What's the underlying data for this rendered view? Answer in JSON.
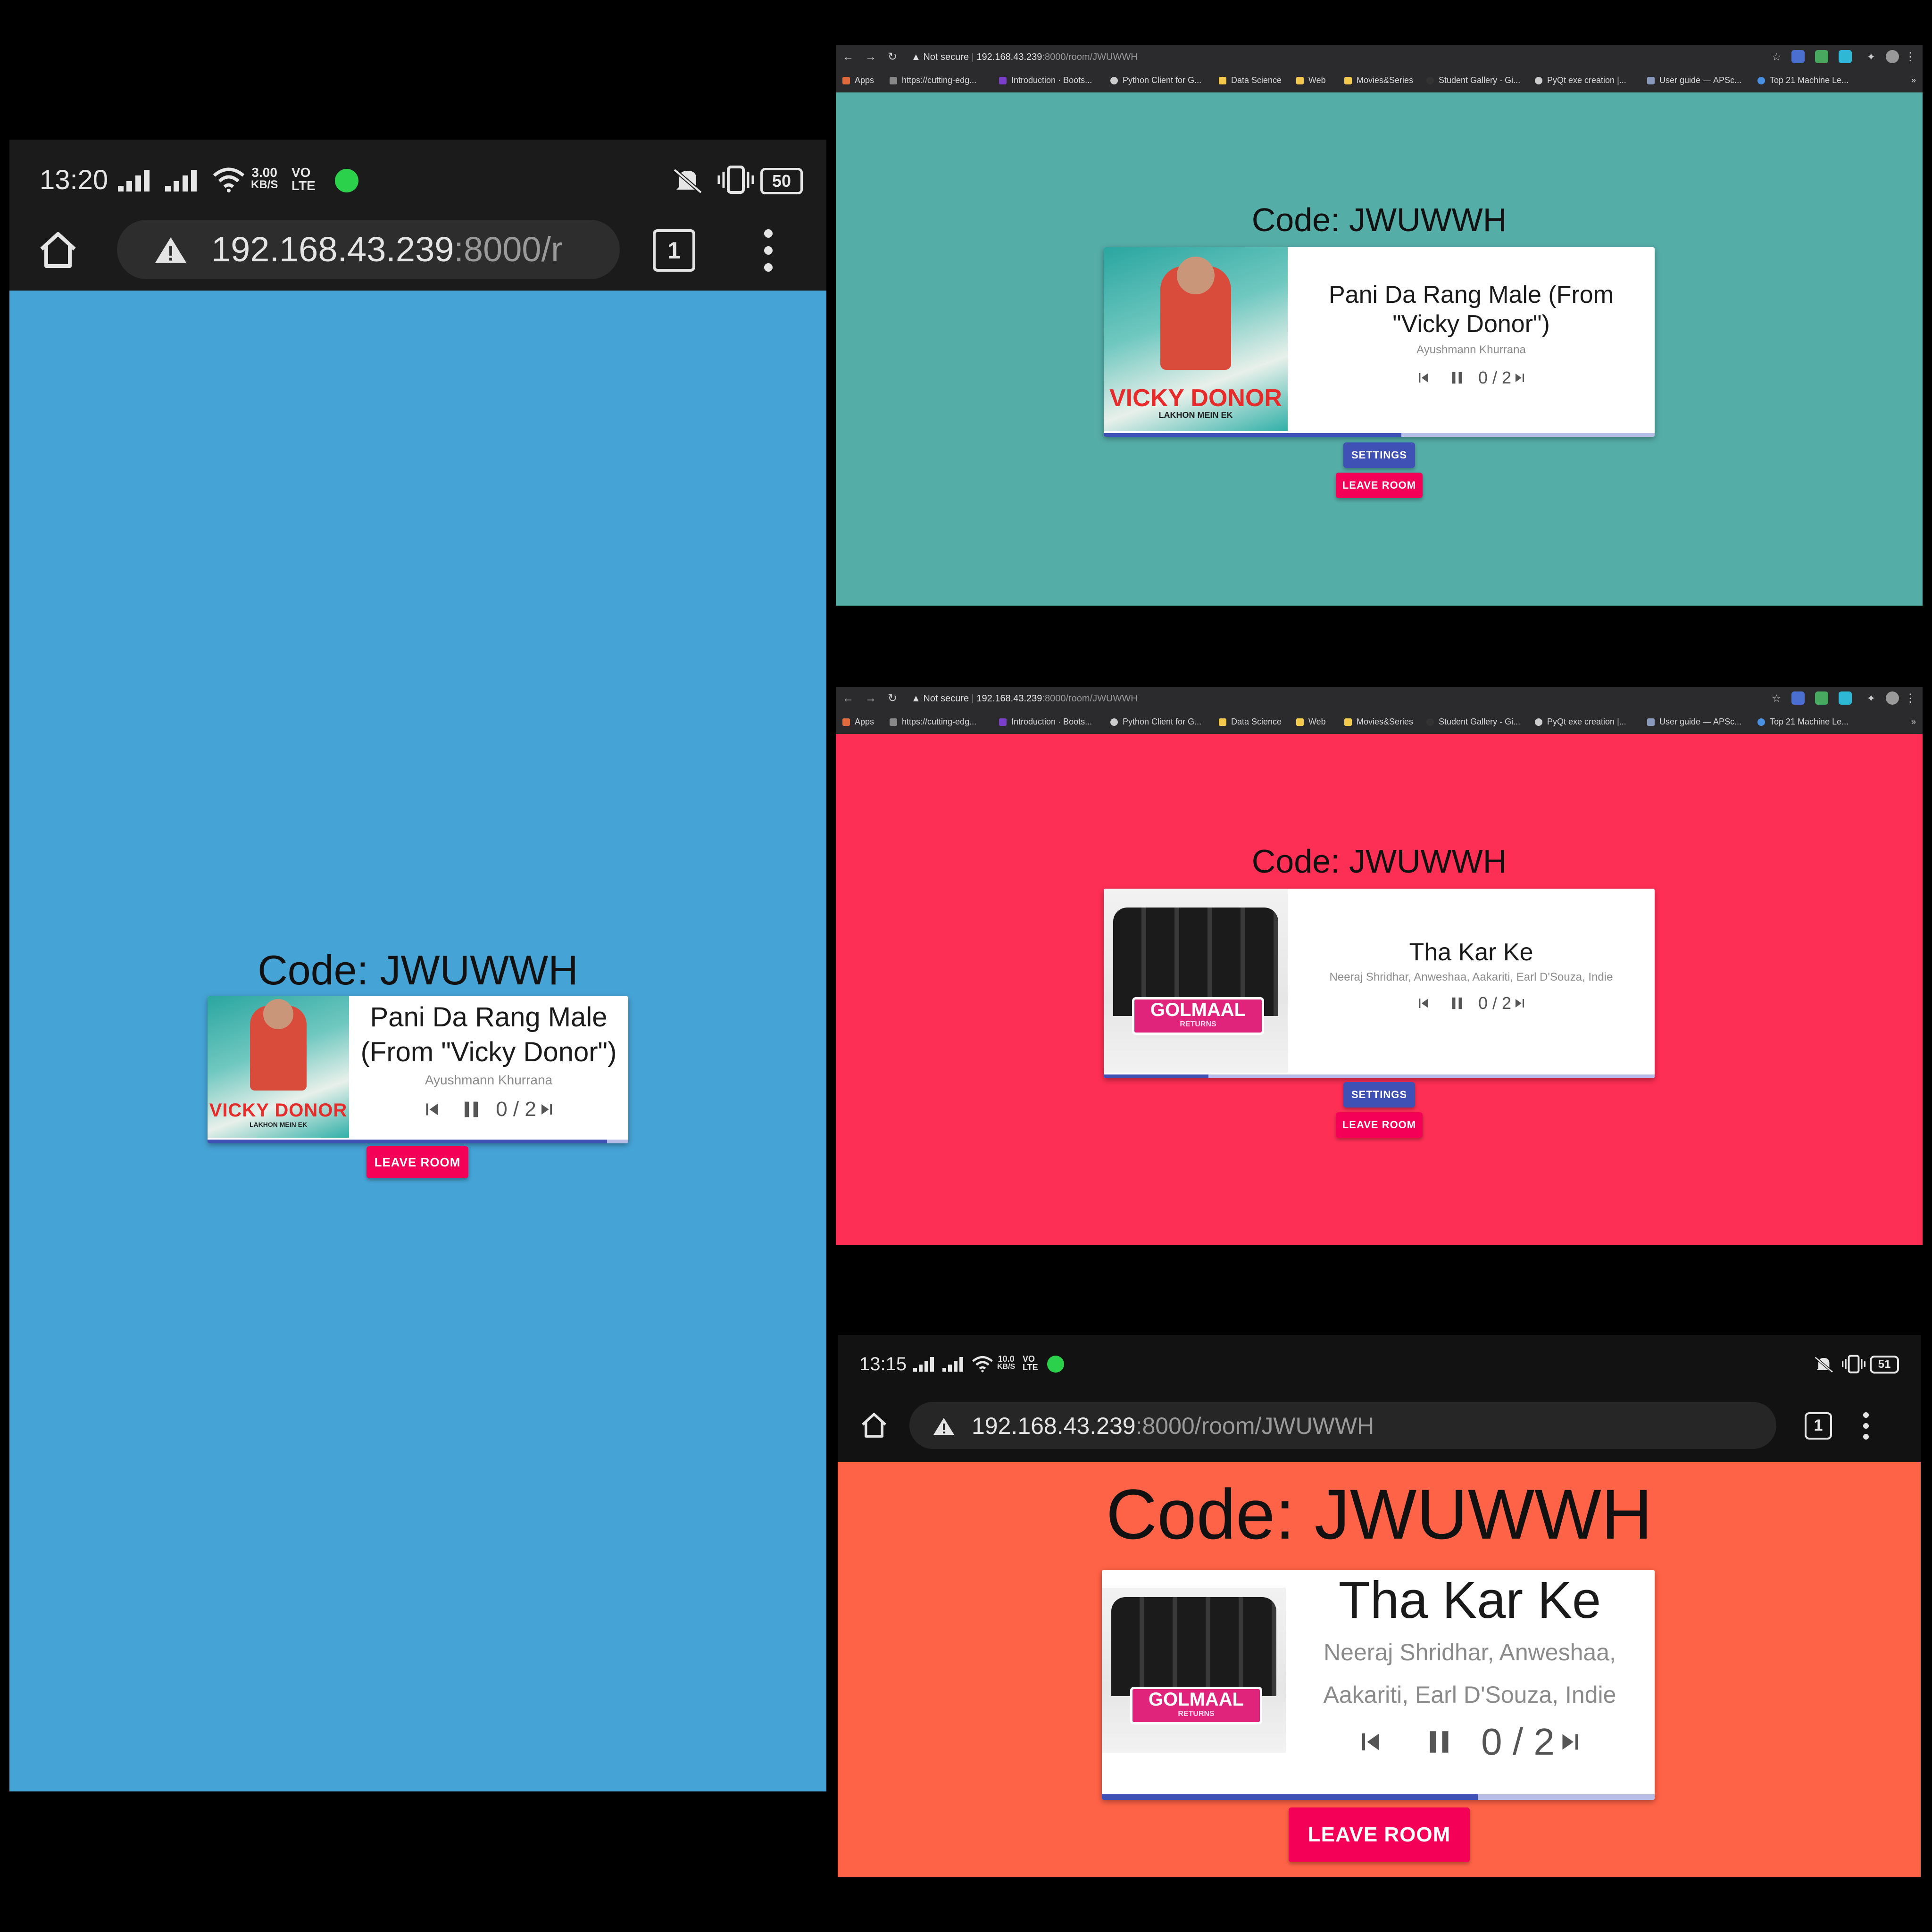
{
  "colors": {
    "panel1_bg": "#46a3d6",
    "panel2_bg": "#55ada8",
    "panel3_bg": "#fe2f55",
    "panel4_bg": "#ff6347",
    "accent_primary": "#3f51b5",
    "accent_secondary": "#f50057"
  },
  "room": {
    "code_label": "Code: JWUWWH",
    "settings_label": "SETTINGS",
    "leave_label": "LEAVE ROOM",
    "votes": "0 / 2"
  },
  "songs": {
    "vicky": {
      "title": "Pani Da Rang Male (From \"Vicky Donor\")",
      "artist": "Ayushmann Khurrana",
      "art_text": "VICKY DONOR",
      "art_subtext": "LAKHON MEIN EK",
      "progress": 0.55
    },
    "golmaal": {
      "title": "Tha Kar Ke",
      "artist": "Neeraj Shridhar, Anweshaa, Aakariti, Earl D'Souza, Indie",
      "art_text": "GOLMAAL",
      "art_subtext": "RETURNS",
      "progress": 0.68
    }
  },
  "phone1": {
    "time": "13:20",
    "speed": "3.00",
    "speed_unit": "KB/S",
    "volte": "VO",
    "volte2": "LTE",
    "battery": "50",
    "url_host": "192.168.43.239",
    "url_rest": ":8000/r",
    "tabs": "1"
  },
  "phone2": {
    "time": "13:15",
    "speed": "10.0",
    "speed_unit": "KB/S",
    "volte": "VO",
    "volte2": "LTE",
    "battery": "51",
    "url_host": "192.168.43.239",
    "url_rest": ":8000/room/JWUWWH",
    "tabs": "1"
  },
  "desktop": {
    "not_secure": "Not secure",
    "url_host": "192.168.43.239",
    "url_rest": ":8000/room/JWUWWH",
    "bookmarks": [
      "Apps",
      "https://cutting-edg...",
      "Introduction · Boots...",
      "Python Client for G...",
      "Data Science",
      "Web",
      "Movies&Series",
      "Student Gallery - Gi...",
      "PyQt exe creation |...",
      "User guide — APSc...",
      "Top 21 Machine Le..."
    ],
    "more": "»"
  }
}
